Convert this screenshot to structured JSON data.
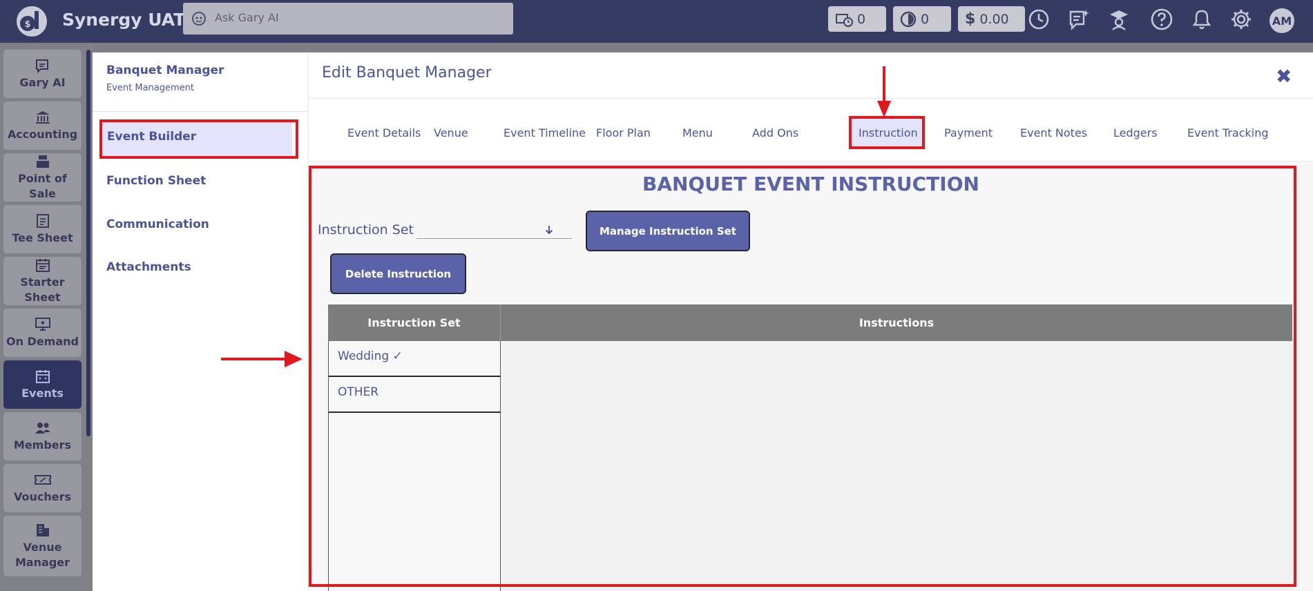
{
  "app": {
    "title": "Synergy UAT"
  },
  "search": {
    "placeholder": "Ask Gary AI"
  },
  "counters": [
    {
      "icon": "cart-clock-icon",
      "value": "0"
    },
    {
      "icon": "timer-icon",
      "value": "0"
    },
    {
      "icon": "dollar-icon",
      "value": "0.00"
    }
  ],
  "user": {
    "initials": "AM"
  },
  "nav": [
    {
      "label": "Gary AI",
      "icon": "gary-ai-icon"
    },
    {
      "label": "Accounting",
      "icon": "bank-icon"
    },
    {
      "label": "Point of Sale",
      "icon": "register-icon"
    },
    {
      "label": "Tee Sheet",
      "icon": "sheet-icon"
    },
    {
      "label": "Starter Sheet",
      "icon": "calendar-icon"
    },
    {
      "label": "On Demand",
      "icon": "monitor-icon"
    },
    {
      "label": "Events",
      "icon": "events-icon"
    },
    {
      "label": "Members",
      "icon": "members-icon"
    },
    {
      "label": "Vouchers",
      "icon": "voucher-icon"
    },
    {
      "label": "Venue Manager",
      "icon": "building-icon"
    }
  ],
  "side": {
    "title": "Banquet Manager",
    "subtitle": "Event Management",
    "items": [
      "Event Builder",
      "Function Sheet",
      "Communication",
      "Attachments"
    ]
  },
  "main": {
    "title": "Edit Banquet Manager",
    "close": "✖",
    "tabs": [
      "Event Details",
      "Venue",
      "Event Timeline",
      "Floor Plan",
      "Menu",
      "Add Ons",
      "Instruction",
      "Payment",
      "Event Notes",
      "Ledgers",
      "Event Tracking"
    ],
    "active_tab": "Instruction"
  },
  "instruction": {
    "heading": "BANQUET EVENT INSTRUCTION",
    "set_label": "Instruction Set",
    "set_value": "",
    "manage_button": "Manage Instruction Set",
    "delete_button": "Delete Instruction",
    "table_headers": [
      "Instruction Set",
      "Instructions"
    ],
    "rows": [
      "Wedding ✓",
      "OTHER"
    ]
  }
}
